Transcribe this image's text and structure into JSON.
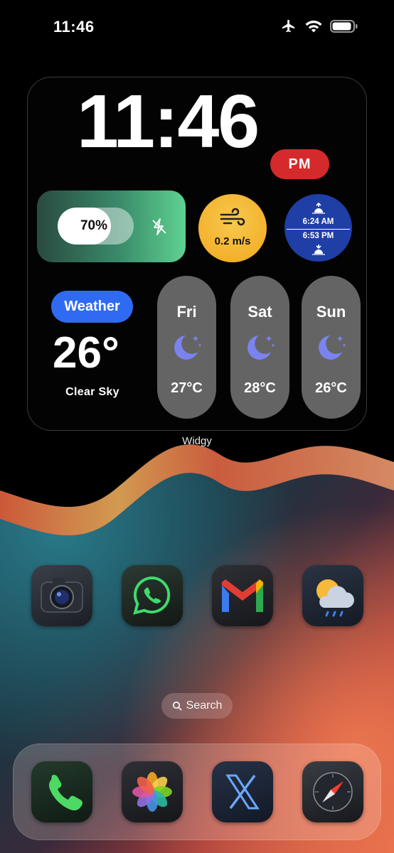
{
  "status_bar": {
    "time": "11:46",
    "icons": [
      "airplane-icon",
      "wifi-icon",
      "battery-icon"
    ]
  },
  "widget": {
    "clock": "11:46",
    "ampm": "PM",
    "battery": {
      "percent_label": "70%",
      "level": 0.7,
      "icon": "charging-bolt-off-icon"
    },
    "wind": {
      "value": "0.2 m/s",
      "icon": "wind-icon"
    },
    "sun": {
      "sunrise": "6:24 AM",
      "sunset": "6:53 PM"
    },
    "weather": {
      "badge": "Weather",
      "temperature": "26°",
      "condition": "Clear Sky"
    },
    "forecast": [
      {
        "day": "Fri",
        "temp": "27°C",
        "icon": "moon-stars-icon"
      },
      {
        "day": "Sat",
        "temp": "28°C",
        "icon": "moon-stars-icon"
      },
      {
        "day": "Sun",
        "temp": "26°C",
        "icon": "moon-stars-icon"
      }
    ],
    "label": "Widgy"
  },
  "apps": [
    {
      "name": "Camera",
      "icon": "camera-icon"
    },
    {
      "name": "WhatsApp",
      "icon": "whatsapp-icon"
    },
    {
      "name": "Gmail",
      "icon": "gmail-icon"
    },
    {
      "name": "Weather",
      "icon": "weather-cloud-rain-icon"
    }
  ],
  "search": {
    "label": "Search"
  },
  "dock": [
    {
      "name": "Phone",
      "icon": "phone-icon"
    },
    {
      "name": "Photos",
      "icon": "photos-icon"
    },
    {
      "name": "X",
      "icon": "x-icon"
    },
    {
      "name": "Safari",
      "icon": "compass-icon"
    }
  ],
  "colors": {
    "ampm_badge": "#d52a2b",
    "weather_badge": "#2f6bf2",
    "wind_circle": "#f3b22d",
    "sun_circle": "#1f3fa6",
    "battery_card": "#5fd191",
    "forecast_pill": "#646464"
  }
}
